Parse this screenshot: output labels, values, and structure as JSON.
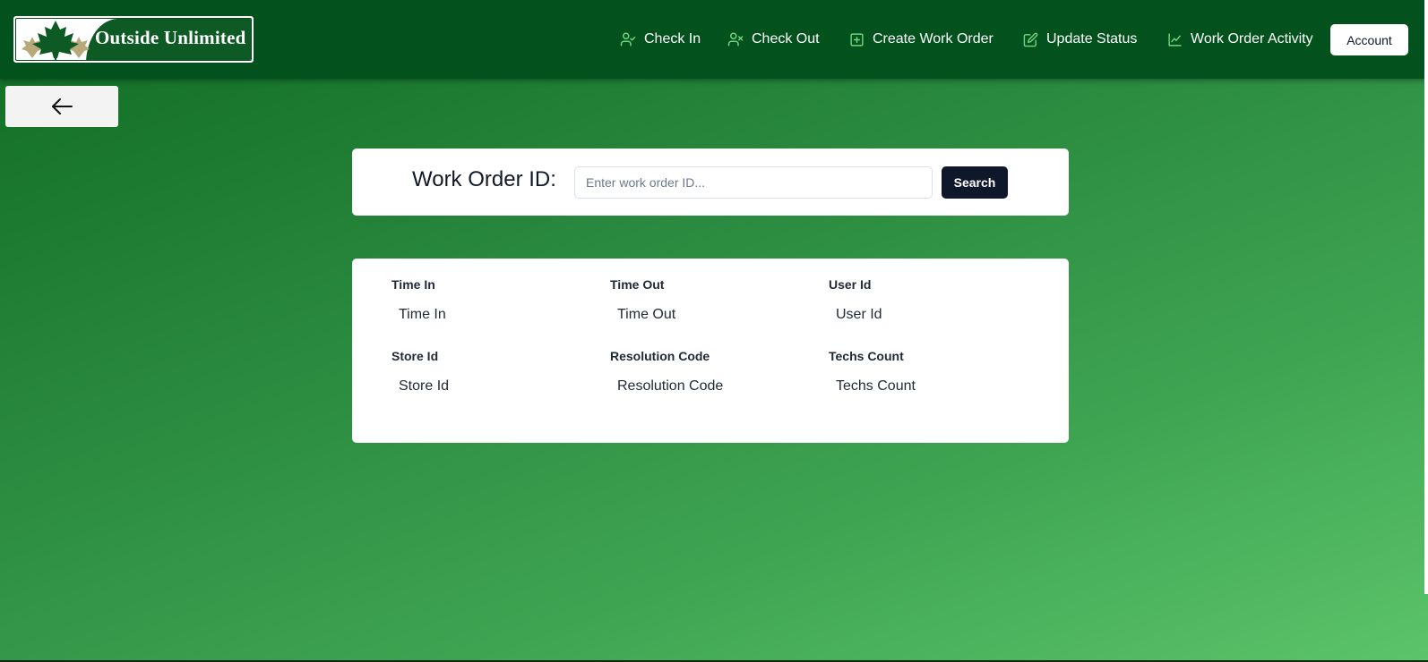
{
  "header": {
    "logo_text": "Outside Unlimited",
    "nav": [
      {
        "label": "Check In",
        "icon": "user-check-icon"
      },
      {
        "label": "Check Out",
        "icon": "user-x-icon"
      },
      {
        "label": "Create Work Order",
        "icon": "plus-square-icon"
      },
      {
        "label": "Update Status",
        "icon": "edit-icon"
      },
      {
        "label": "Work Order Activity",
        "icon": "line-chart-icon"
      }
    ],
    "account_label": "Account"
  },
  "back": {
    "icon": "arrow-left-icon"
  },
  "search": {
    "label": "Work Order ID:",
    "placeholder": "Enter work order ID...",
    "value": "",
    "button_label": "Search"
  },
  "details": {
    "fields": [
      {
        "label": "Time In",
        "value": "Time In"
      },
      {
        "label": "Time Out",
        "value": "Time Out"
      },
      {
        "label": "User Id",
        "value": "User Id"
      },
      {
        "label": "Store Id",
        "value": "Store Id"
      },
      {
        "label": "Resolution Code",
        "value": "Resolution Code"
      },
      {
        "label": "Techs Count",
        "value": "Techs Count"
      }
    ]
  },
  "colors": {
    "header_bg": "#03521d",
    "icon_accent": "#6fd67f",
    "search_button_bg": "#0f172a"
  }
}
